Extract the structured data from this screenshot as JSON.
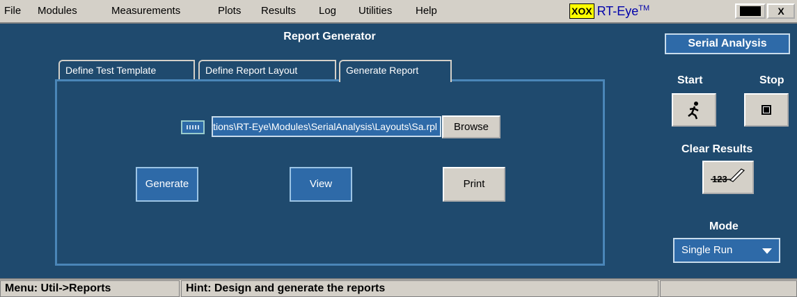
{
  "menu": {
    "items": [
      "File",
      "Modules",
      "Measurements",
      "Plots",
      "Results",
      "Log",
      "Utilities",
      "Help"
    ]
  },
  "brand": {
    "logo_box": "XOX",
    "name": "RT-Eye",
    "tm": "TM"
  },
  "window_controls": {
    "minimize_icon": "minimize-icon",
    "close_label": "X"
  },
  "report": {
    "title": "Report Generator",
    "tabs": [
      {
        "label": "Define Test Template",
        "active": false
      },
      {
        "label": "Define Report Layout",
        "active": false
      },
      {
        "label": "Generate Report",
        "active": true
      }
    ],
    "path_value": "C:\\TekApplications\\RT-Eye\\Modules\\SerialAnalysis\\Layouts\\Sa.rpl",
    "browse_label": "Browse",
    "generate_label": "Generate",
    "view_label": "View",
    "print_label": "Print"
  },
  "side_panel": {
    "title": "Serial Analysis",
    "start_label": "Start",
    "stop_label": "Stop",
    "start_icon": "running-man-icon",
    "stop_icon": "stop-square-icon",
    "clear_label": "Clear Results",
    "clear_icon": "clear-123-icon",
    "mode_label": "Mode",
    "mode_value": "Single Run"
  },
  "status": {
    "menu_text": "Menu: Util->Reports",
    "hint_text": "Hint: Design and generate the reports"
  },
  "colors": {
    "panel_bg": "#1f4a6e",
    "accent_blue": "#2e6aa8",
    "chrome_gray": "#d4d0c8"
  }
}
